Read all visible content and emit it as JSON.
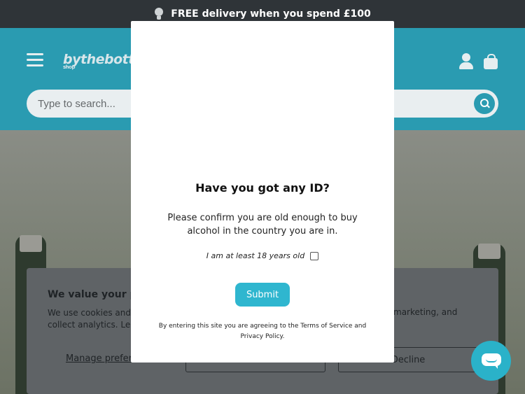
{
  "announcement": {
    "icon": "lightbulb-icon",
    "text": "FREE delivery when you spend £100"
  },
  "header": {
    "logo_text": "bythebottle",
    "logo_sub": "shop",
    "menu_icon": "hamburger-menu-icon",
    "account_icon": "user-icon",
    "cart_icon": "shopping-bag-icon"
  },
  "search": {
    "placeholder": "Type to search...",
    "button_icon": "search-icon"
  },
  "cookie_banner": {
    "title": "We value your pr",
    "text_left": "We use cookies and",
    "text_left_line2": "collect analytics. Le",
    "text_right": "marketing, and",
    "manage_label": "Manage prefere",
    "decline_label": "Decline"
  },
  "age_modal": {
    "title": "Have you got any ID?",
    "message": "Please confirm you are old enough to buy alcohol in the country you are in.",
    "checkbox_label": "I am at least 18 years old",
    "submit_label": "Submit",
    "terms": "By entering this site you are agreeing to the Terms of Service and Privacy Policy."
  },
  "chat": {
    "icon": "chat-bubble-icon"
  },
  "colors": {
    "brand_teal": "#2a9bb1",
    "submit_button": "#2fb6cf",
    "announcement_bg": "#2f3438"
  }
}
